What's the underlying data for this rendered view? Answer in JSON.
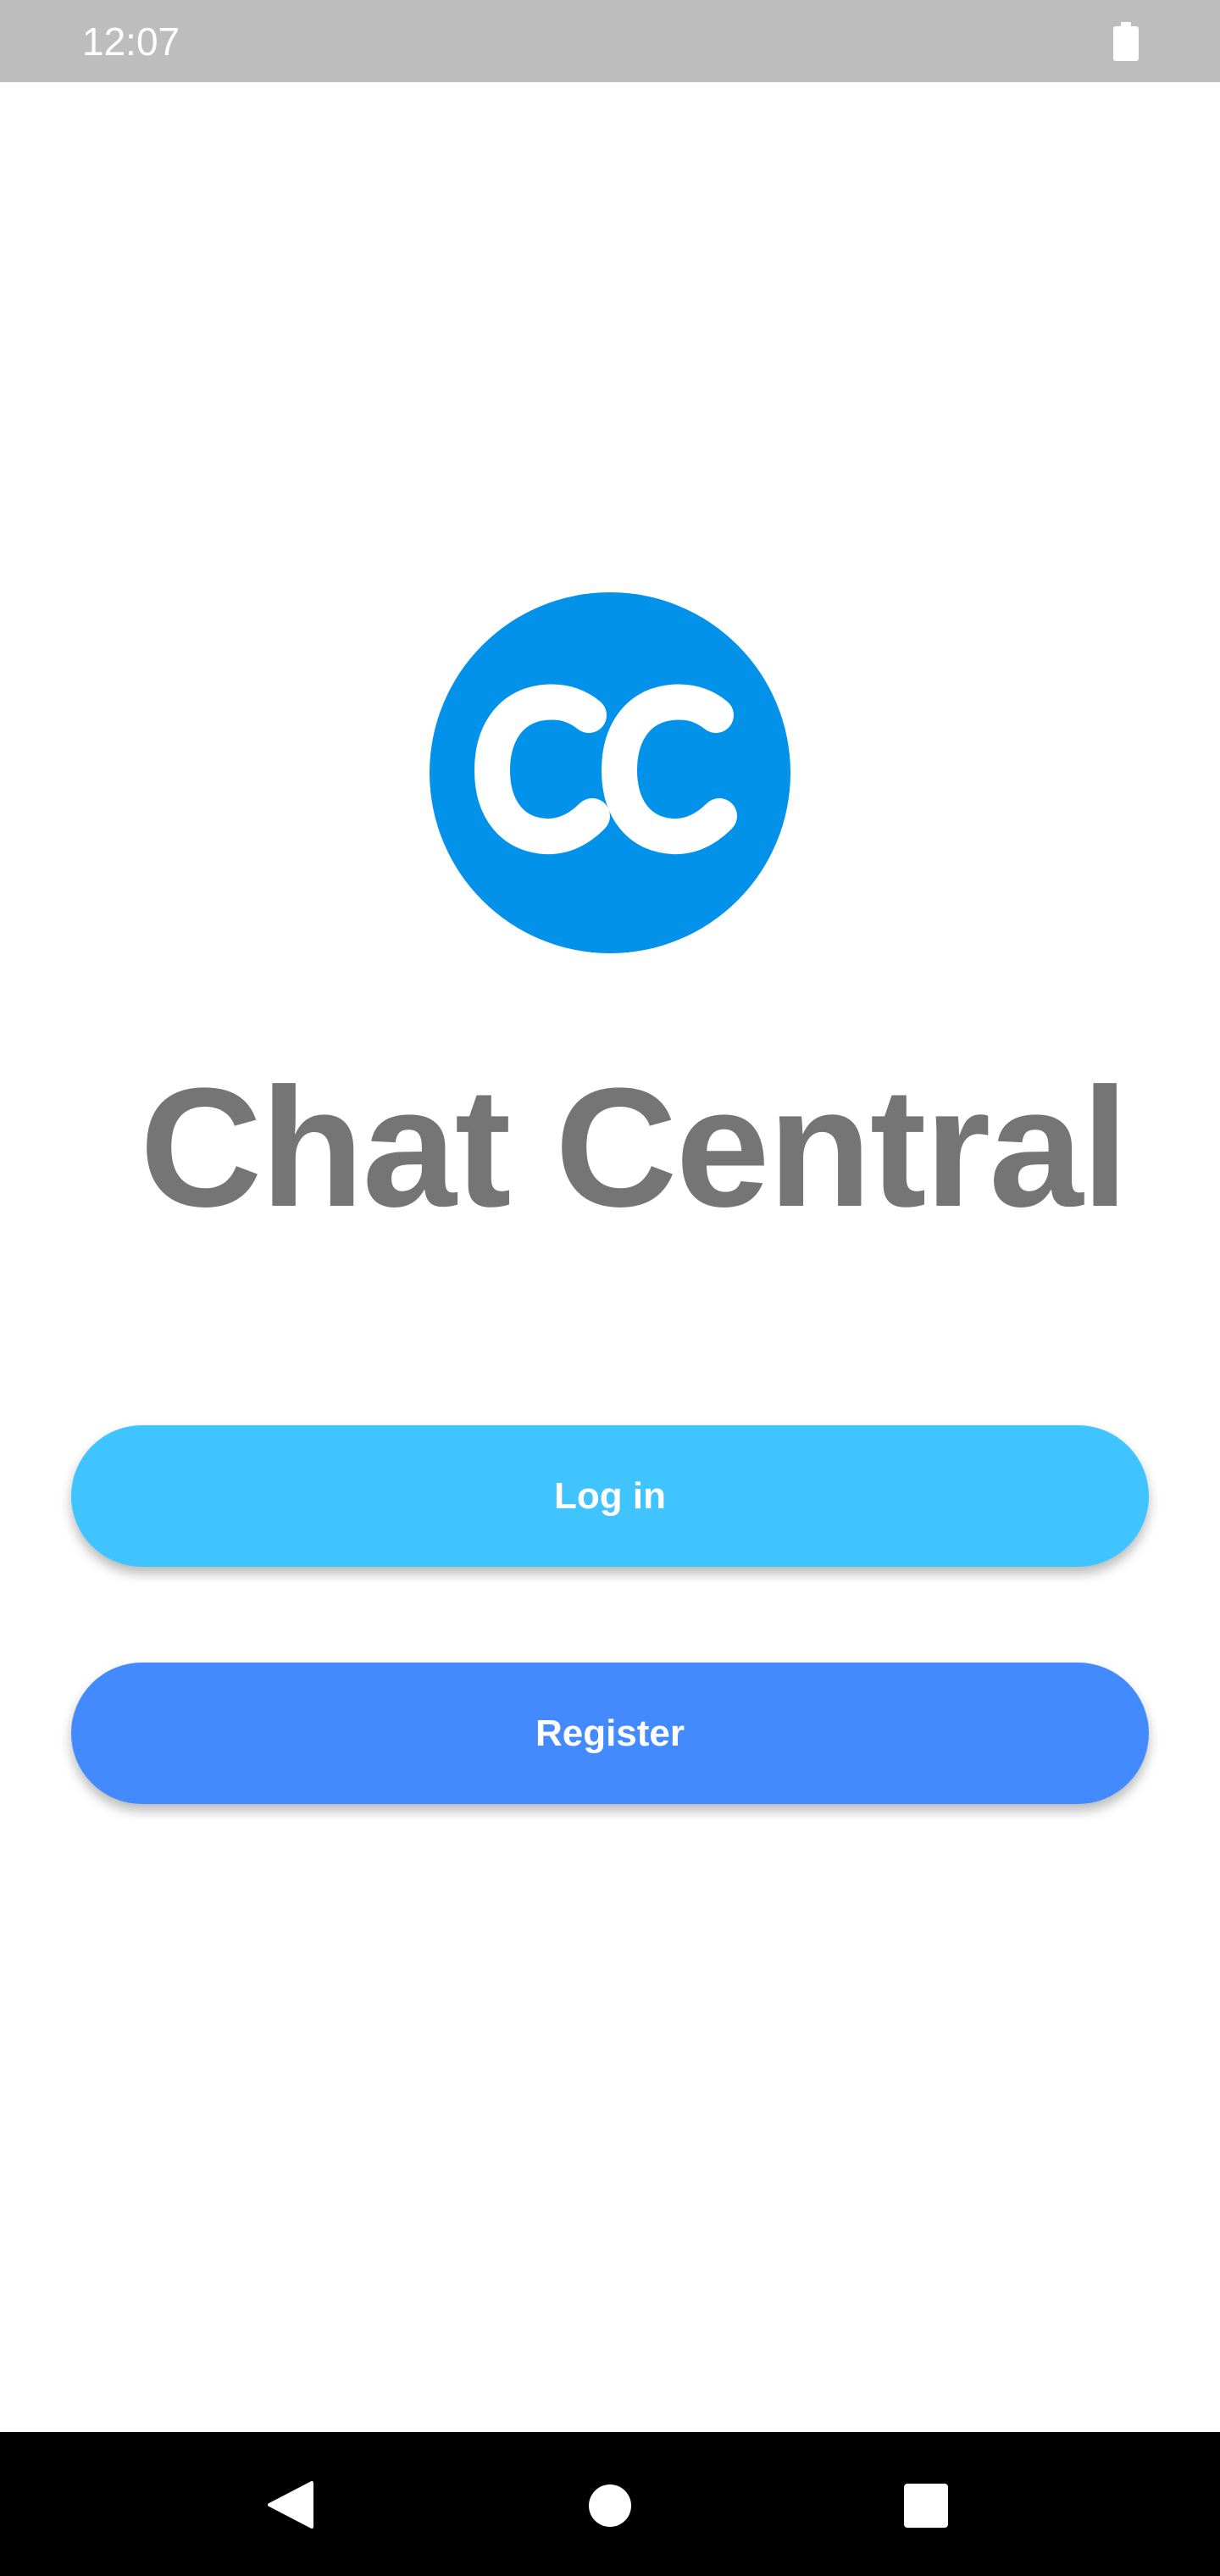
{
  "status_bar": {
    "time": "12:07",
    "battery_icon": "battery-full-icon"
  },
  "logo": {
    "text": "CC",
    "color": "#0392ea"
  },
  "app": {
    "title": "Chat Central"
  },
  "buttons": {
    "login_label": "Log in",
    "register_label": "Register",
    "login_color": "#40c4ff",
    "register_color": "#448aff"
  },
  "nav_bar": {
    "back_icon": "back-triangle-icon",
    "home_icon": "home-circle-icon",
    "recents_icon": "recents-square-icon"
  }
}
